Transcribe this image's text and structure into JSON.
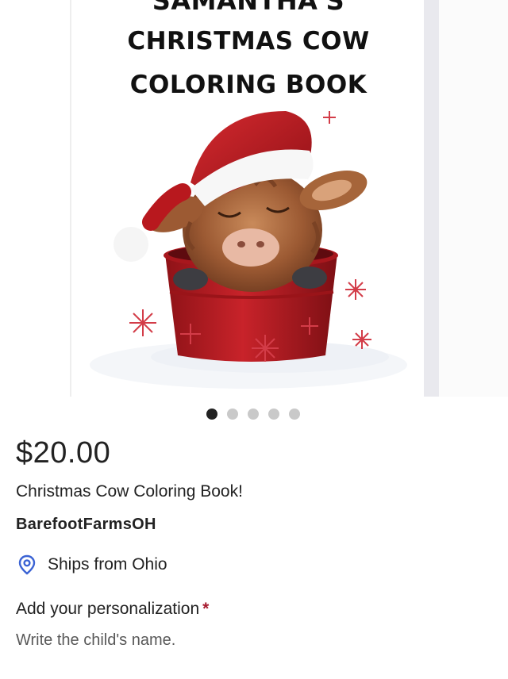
{
  "cover": {
    "title_lines": [
      "SAMANTHA'S",
      "CHRISTMAS COW",
      "COLORING BOOK"
    ]
  },
  "carousel": {
    "total_slides": 5,
    "active_index": 0
  },
  "listing": {
    "price": "$20.00",
    "title": "Christmas Cow Coloring Book!",
    "shop_name": "BarefootFarmsOH",
    "ships_from": "Ships from Ohio",
    "ships_icon": "location-pin-icon"
  },
  "personalization": {
    "label": "Add your personalization",
    "required_marker": "*",
    "instructions": "Write the child's name."
  },
  "colors": {
    "required": "#a61a2e",
    "pin_icon": "#3b63d4",
    "active_dot": "#222222",
    "inactive_dot": "#c9c9c9"
  }
}
